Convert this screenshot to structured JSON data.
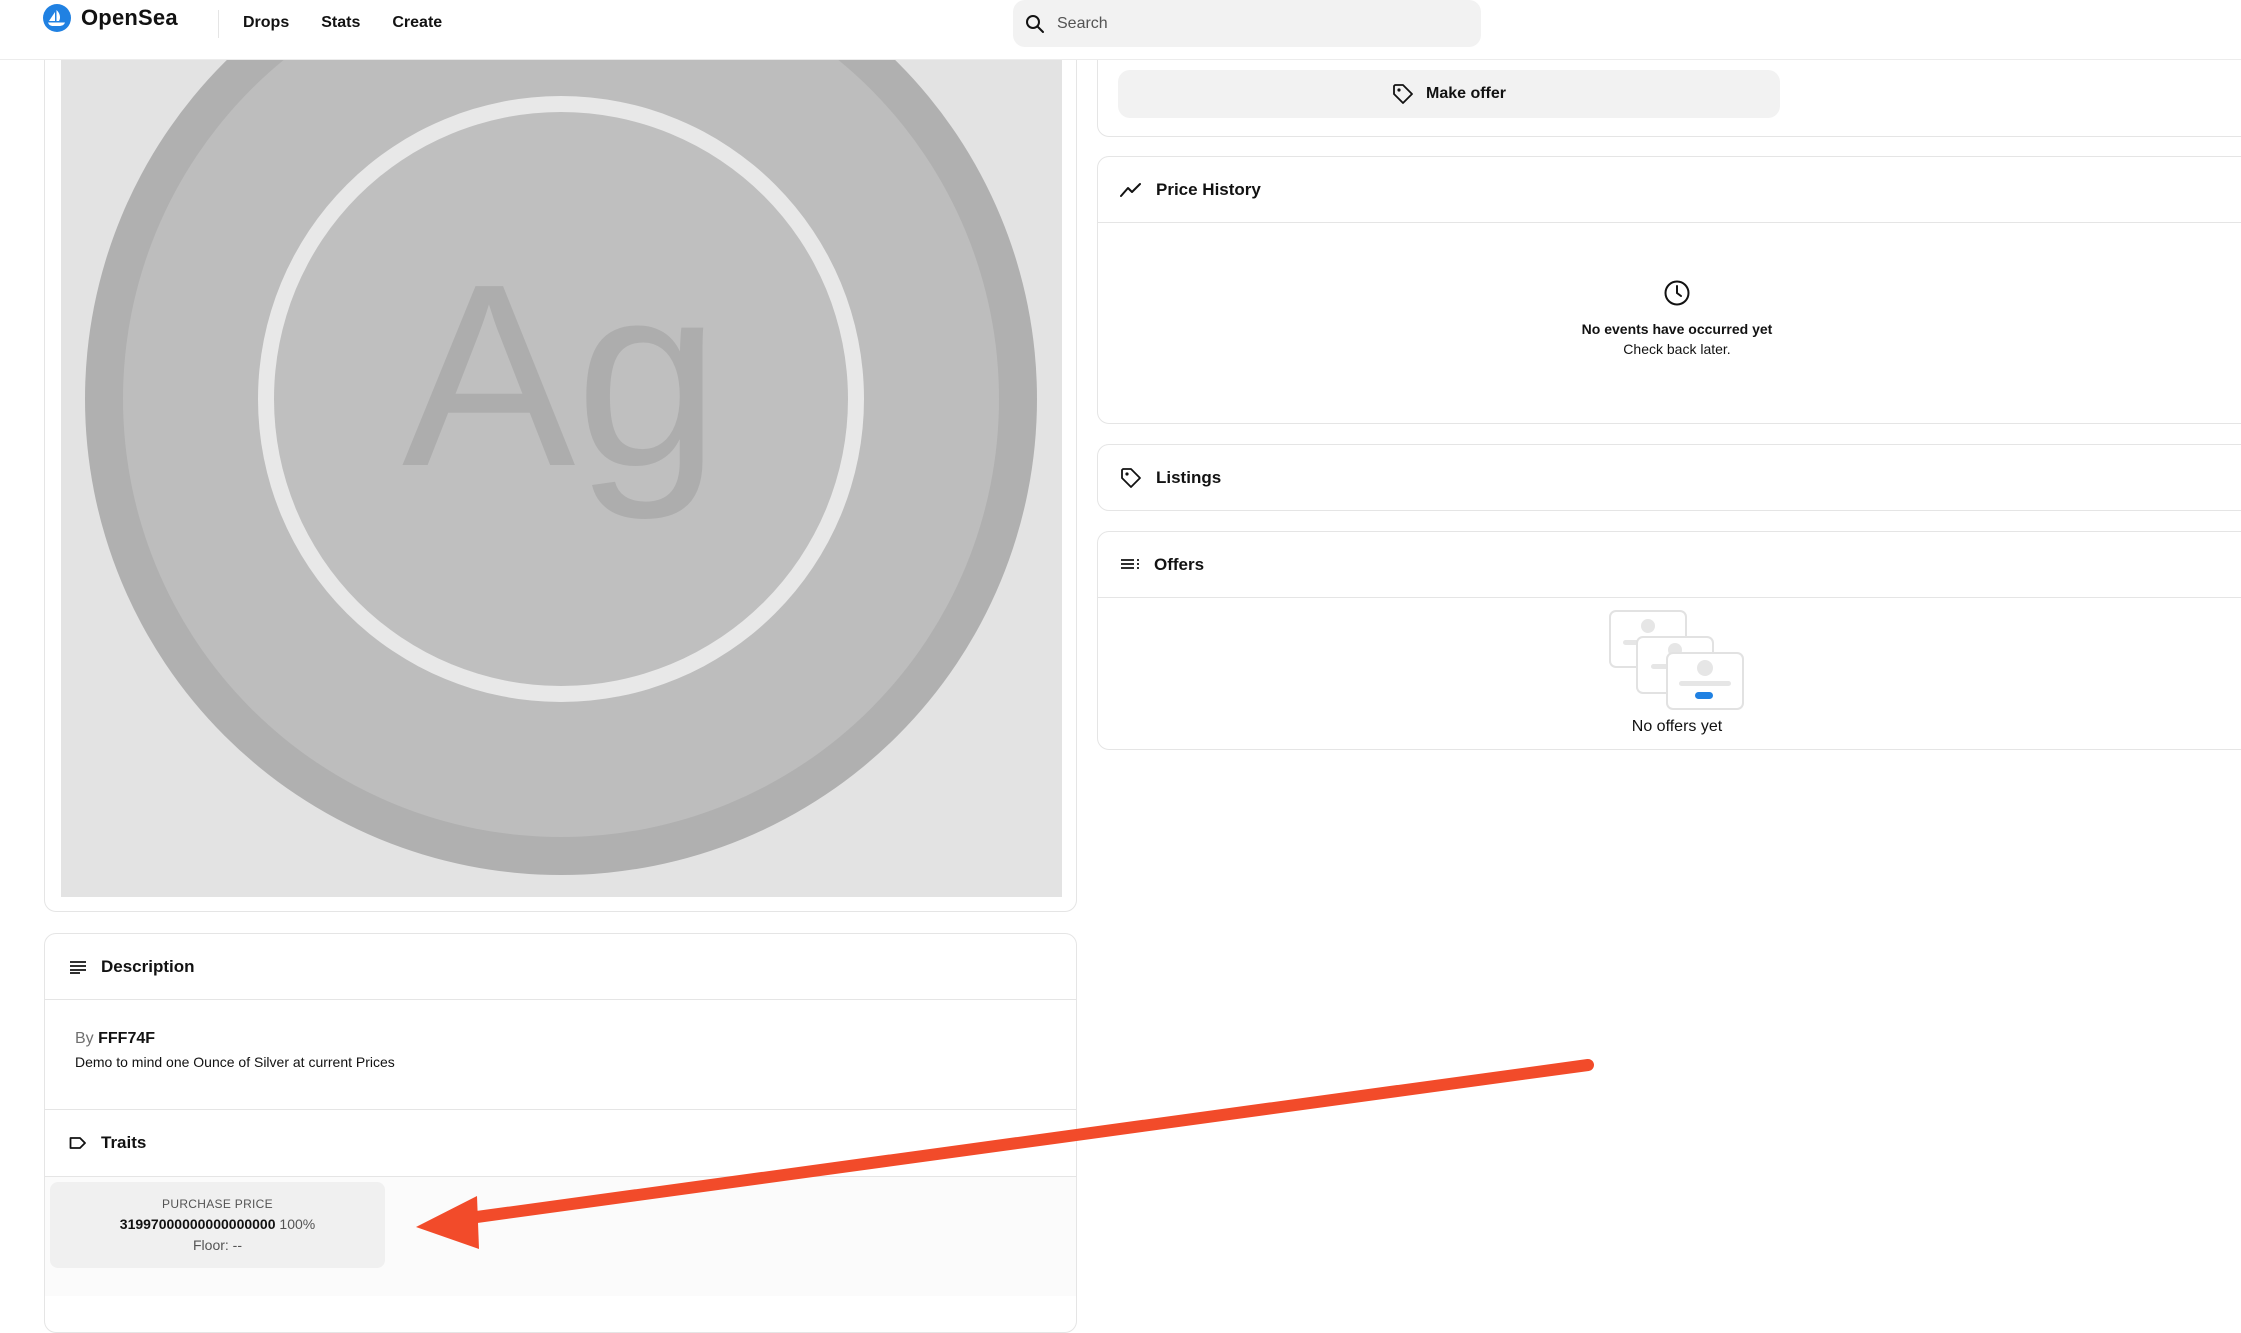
{
  "header": {
    "brand": "OpenSea",
    "nav": [
      {
        "label": "Drops"
      },
      {
        "label": "Stats"
      },
      {
        "label": "Create"
      }
    ],
    "search_placeholder": "Search"
  },
  "media": {
    "symbol": "Ag"
  },
  "actions": {
    "make_offer_label": "Make offer"
  },
  "price_history": {
    "title": "Price History",
    "empty_title": "No events have occurred yet",
    "empty_subtitle": "Check back later."
  },
  "listings": {
    "title": "Listings"
  },
  "offers": {
    "title": "Offers",
    "empty_text": "No offers yet"
  },
  "description": {
    "title": "Description",
    "by_prefix": "By",
    "creator": "FFF74F",
    "text": "Demo to mind one Ounce of Silver at current Prices"
  },
  "traits": {
    "title": "Traits",
    "items": [
      {
        "type": "PURCHASE PRICE",
        "value": "31997000000000000000",
        "percent": "100%",
        "floor": "Floor: --"
      }
    ]
  },
  "colors": {
    "brand_blue": "#2081E2",
    "annotation_arrow": "#F24B2A"
  }
}
